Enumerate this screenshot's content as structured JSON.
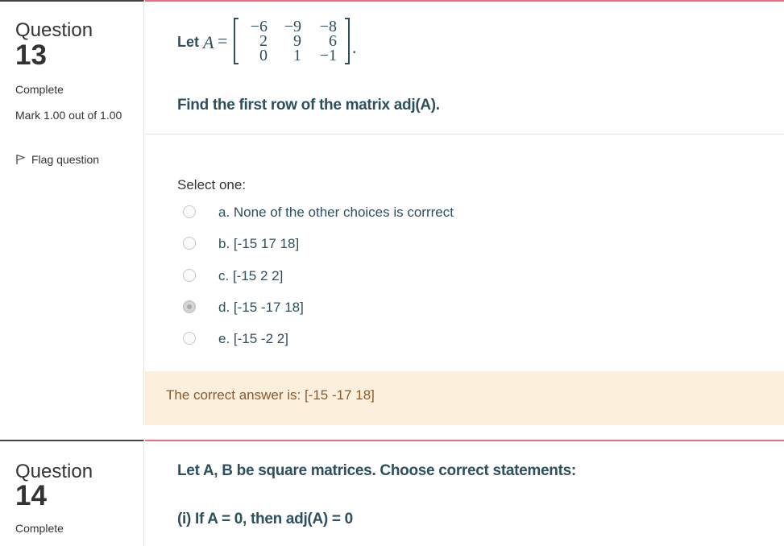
{
  "q13": {
    "label": "Question",
    "number": "13",
    "state": "Complete",
    "grade": "Mark 1.00 out of 1.00",
    "flag": "Flag question",
    "stem_let": "Let",
    "matrix_name": "A",
    "matrix_eq": "=",
    "matrix_period": ".",
    "matrix": [
      [
        "−6",
        "−9",
        "−8"
      ],
      [
        "2",
        "9",
        "6"
      ],
      [
        "0",
        "1",
        "−1"
      ]
    ],
    "question": "Find the first row of the matrix adj(A).",
    "prompt": "Select one:",
    "options": [
      {
        "label": "a. None of the other choices is corrrect",
        "checked": false
      },
      {
        "label": "b. [-15 17 18]",
        "checked": false
      },
      {
        "label": "c. [-15 2 2]",
        "checked": false
      },
      {
        "label": "d. [-15 -17 18]",
        "checked": true
      },
      {
        "label": "e. [-15 -2 2]",
        "checked": false
      }
    ],
    "feedback": "The correct answer is: [-15 -17 18]"
  },
  "q14": {
    "label": "Question",
    "number": "14",
    "state": "Complete",
    "text1": "Let A, B be square matrices. Choose correct statements:",
    "text2": "(i) If A = 0, then adj(A) = 0"
  },
  "colors": {
    "accent_border": "#f06a84",
    "text_teal": "#2d4f5e",
    "feedback_bg": "#fcefdc",
    "feedback_text": "#8a5a2b"
  },
  "icons": {
    "flag": "flag-icon"
  }
}
